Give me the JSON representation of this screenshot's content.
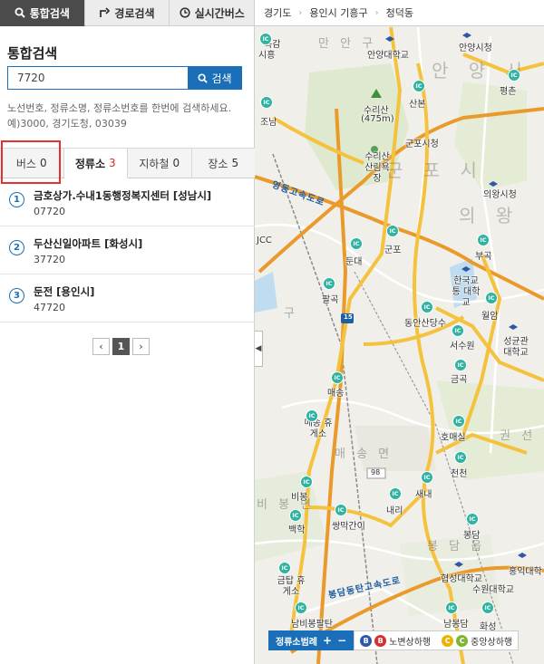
{
  "top_tabs": [
    {
      "label": "통합검색",
      "icon": "search-icon"
    },
    {
      "label": "경로검색",
      "icon": "route-icon"
    },
    {
      "label": "실시간버스",
      "icon": "clock-icon"
    }
  ],
  "search": {
    "title": "통합검색",
    "value": "7720",
    "button_label": "검색",
    "help_text": "노선번호, 정류소명, 정류소번호를 한번에 검색하세요. 예)3000, 경기도청, 03039"
  },
  "result_tabs": [
    {
      "label": "버스",
      "count": "0"
    },
    {
      "label": "정류소",
      "count": "3"
    },
    {
      "label": "지하철",
      "count": "0"
    },
    {
      "label": "장소",
      "count": "5"
    }
  ],
  "results": [
    {
      "num": "1",
      "name": "금호상가.수내1동행정복지센터 [성남시]",
      "code": "07720"
    },
    {
      "num": "2",
      "name": "두산신일아파트 [화성시]",
      "code": "37720"
    },
    {
      "num": "3",
      "name": "둔전 [용인시]",
      "code": "47720"
    }
  ],
  "pager": {
    "prev": "‹",
    "current": "1",
    "next": "›"
  },
  "breadcrumb": [
    "경기도",
    "용인시 기흥구",
    "청덕동"
  ],
  "map": {
    "collapse_arrow": "◀",
    "ic_label": "IC",
    "big_labels": [
      "안 양 시",
      "군 포 시",
      "의 왕",
      "만 안 구"
    ],
    "district_labels": [
      "매 송 면",
      "봉 담 읍",
      "비 봉 면",
      "권 선",
      "구"
    ],
    "mountain": "수리산",
    "mountain_height": "(475m)",
    "places": [
      "목감",
      "시흥",
      "조남",
      "산본",
      "평촌",
      "안양시청",
      "안양대학교",
      "군포시청",
      "수리산 산림욕장",
      "의왕시청",
      "군포",
      "둔대",
      "부곡",
      "한국교통 대학교",
      "팔곡",
      "동안산당수",
      "월암",
      "성균관 대학교",
      "서수원",
      "매송",
      "금곡",
      "매송 휴게소",
      "호매실",
      "천천",
      "비봉",
      "새내",
      "내리",
      "쌍막간이",
      "백학",
      "봉담",
      "협성대학교",
      "홍익대학",
      "금탑 휴게소",
      "수원대학교",
      "남비봉팔탄",
      "화성",
      "남봉담",
      "JCC"
    ],
    "highways": [
      "영동고속도로",
      "봉담동탄고속도로"
    ],
    "route_shields": [
      "15",
      "98"
    ]
  },
  "bottom_bar": {
    "range_label": "정류소범례",
    "plus": "+",
    "minus": "−",
    "roadside_label": "노변상하행",
    "center_label": "중앙상하행",
    "badge_roadside": "B",
    "badge_center": "C"
  },
  "colors": {
    "accent": "#1a6fb8",
    "active_tab": "#4b4b4b",
    "count_red": "#d52b1e",
    "highlight": "#e53030",
    "ic_green": "#2fb4a2",
    "road_yellow": "#f5c23d",
    "road_orange": "#ea9a2b"
  }
}
